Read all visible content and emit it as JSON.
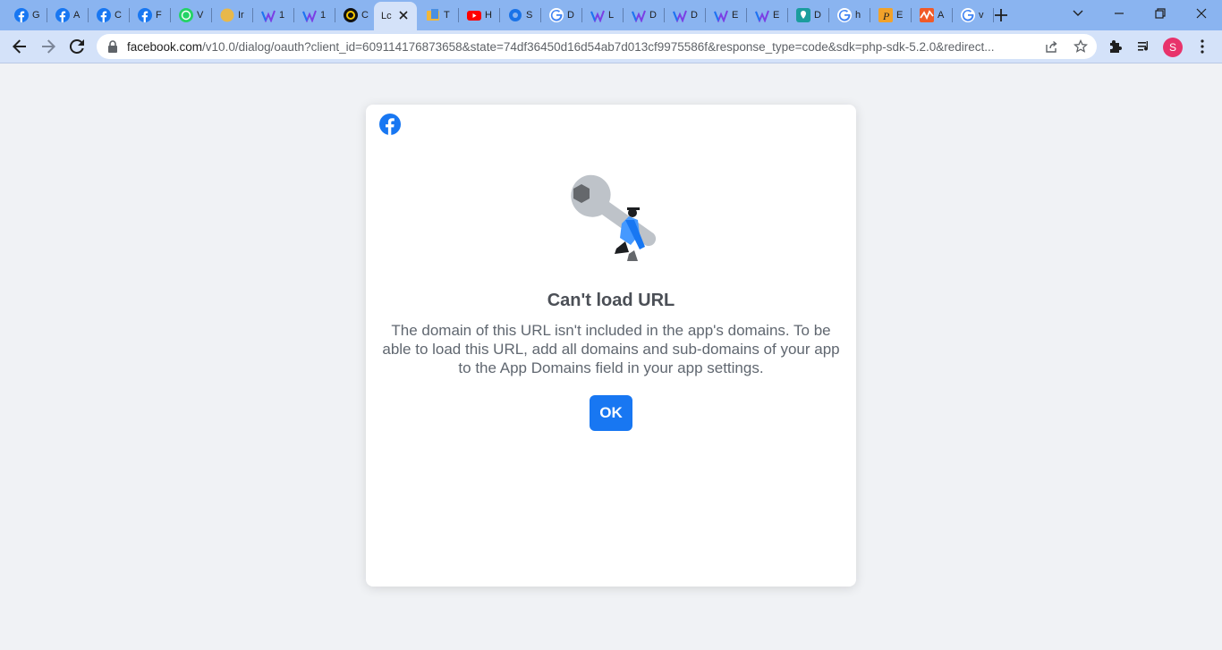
{
  "browser": {
    "tabs": [
      {
        "icon": "facebook-icon",
        "title": "G"
      },
      {
        "icon": "facebook-icon",
        "title": "A"
      },
      {
        "icon": "facebook-icon",
        "title": "C"
      },
      {
        "icon": "facebook-icon",
        "title": "F"
      },
      {
        "icon": "whatsapp-icon",
        "title": "V"
      },
      {
        "icon": "folder-icon",
        "title": "Ir"
      },
      {
        "icon": "wave-icon",
        "title": "1"
      },
      {
        "icon": "wave-icon",
        "title": "1"
      },
      {
        "icon": "q-icon",
        "title": "C"
      },
      {
        "icon": "blank-page-icon",
        "title": "Lc",
        "active": true
      },
      {
        "icon": "file-icon",
        "title": "T"
      },
      {
        "icon": "youtube-icon",
        "title": "H"
      },
      {
        "icon": "globe-icon",
        "title": "S"
      },
      {
        "icon": "google-icon",
        "title": "D"
      },
      {
        "icon": "wave-icon",
        "title": "L"
      },
      {
        "icon": "wave-icon",
        "title": "D"
      },
      {
        "icon": "wave-icon",
        "title": "D"
      },
      {
        "icon": "wave-icon",
        "title": "E"
      },
      {
        "icon": "wave-icon",
        "title": "E"
      },
      {
        "icon": "map-pin-icon",
        "title": "D"
      },
      {
        "icon": "google-icon",
        "title": "h"
      },
      {
        "icon": "p-icon",
        "title": "E"
      },
      {
        "icon": "pulse-icon",
        "title": "A"
      },
      {
        "icon": "google-icon",
        "title": "v"
      }
    ],
    "address": {
      "host": "facebook.com",
      "path": "/v10.0/dialog/oauth?client_id=609114176873658&state=74df36450d16d54ab7d013cf9975586f&response_type=code&sdk=php-sdk-5.2.0&redirect..."
    },
    "profile_initial": "S"
  },
  "dialog": {
    "title": "Can't load URL",
    "message": "The domain of this URL isn't included in the app's domains. To be able to load this URL, add all domains and sub-domains of your app to the App Domains field in your app settings.",
    "ok_label": "OK"
  },
  "colors": {
    "facebook_blue": "#1877f2",
    "page_bg": "#f0f2f5",
    "tabstrip_bg": "#8ab4f0",
    "toolbar_bg": "#d4e2f9"
  }
}
